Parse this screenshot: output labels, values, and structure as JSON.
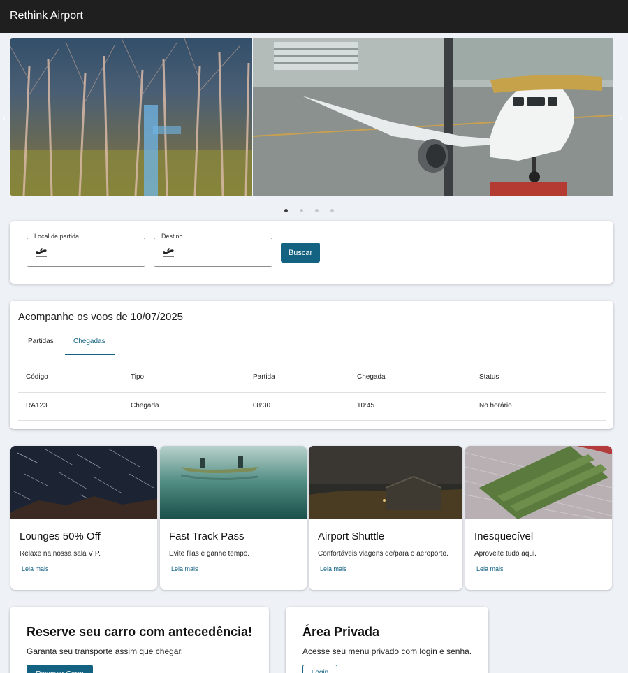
{
  "appbar": {
    "title": "Rethink Airport"
  },
  "carousel": {
    "slides": [
      {
        "icon": "trees-photo"
      },
      {
        "icon": "airplane-photo"
      }
    ],
    "prev_icon": "chevron-left-icon",
    "next_icon": "chevron-right-icon",
    "dots_count": 4,
    "active_dot": 1
  },
  "search": {
    "origin_label": "Local de partida",
    "origin_value": "",
    "origin_icon": "flight-takeoff-icon",
    "destination_label": "Destino",
    "destination_value": "",
    "destination_icon": "flight-takeoff-icon",
    "button_label": "Buscar"
  },
  "flights": {
    "title": "Acompanhe os voos de 10/07/2025",
    "tabs": [
      {
        "label": "Partidas"
      },
      {
        "label": "Chegadas"
      }
    ],
    "active_tab": "Chegadas",
    "columns": [
      "Código",
      "Tipo",
      "Partida",
      "Chegada",
      "Status"
    ],
    "rows": [
      [
        "RA123",
        "Chegada",
        "08:30",
        "10:45",
        "No horário"
      ]
    ]
  },
  "promos": [
    {
      "title": "Lounges 50% Off",
      "description": "Relaxe na nossa sala VIP.",
      "link": "Leia mais",
      "image": "star-trails-photo"
    },
    {
      "title": "Fast Track Pass",
      "description": "Evite filas e ganhe tempo.",
      "link": "Leia mais",
      "image": "canoe-lake-photo"
    },
    {
      "title": "Airport Shuttle",
      "description": "Confortáveis viagens de/para o aeroporto.",
      "link": "Leia mais",
      "image": "barn-night-photo"
    },
    {
      "title": "Inesquecível",
      "description": "Aproveite tudo aqui.",
      "link": "Leia mais",
      "image": "stadium-aerial-photo"
    }
  ],
  "car_reservation": {
    "title": "Reserve seu carro com antecedência!",
    "description": "Garanta seu transporte assim que chegar.",
    "button_label": "Reservar Carro"
  },
  "private_area": {
    "title": "Área Privada",
    "description": "Acesse seu menu privado com login e senha.",
    "button_label": "Login"
  },
  "colors": {
    "appbar": "#1f1f1f",
    "primary": "#136281",
    "background": "#eef1f6"
  }
}
